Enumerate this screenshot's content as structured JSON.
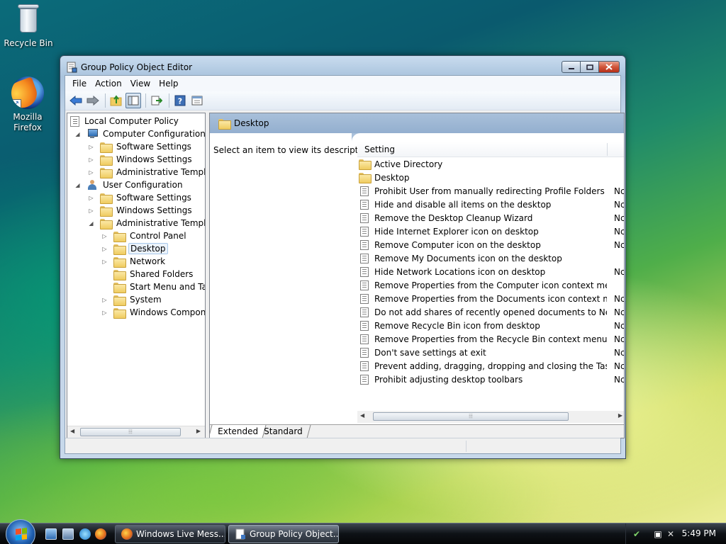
{
  "desktop": {
    "icons": [
      {
        "label": "Recycle Bin"
      },
      {
        "label": "Mozilla Firefox"
      }
    ]
  },
  "window": {
    "title": "Group Policy Object Editor",
    "menu": [
      "File",
      "Action",
      "View",
      "Help"
    ],
    "tree": [
      {
        "label": "Local Computer Policy",
        "icon": "policy-icon"
      },
      {
        "label": "Computer Configuration",
        "icon": "computer-icon"
      },
      {
        "label": "Software Settings",
        "icon": "folder-icon"
      },
      {
        "label": "Windows Settings",
        "icon": "folder-icon"
      },
      {
        "label": "Administrative Templates",
        "icon": "folder-icon"
      },
      {
        "label": "User Configuration",
        "icon": "user-icon"
      },
      {
        "label": "Software Settings",
        "icon": "folder-icon"
      },
      {
        "label": "Windows Settings",
        "icon": "folder-icon"
      },
      {
        "label": "Administrative Templates",
        "icon": "folder-icon"
      },
      {
        "label": "Control Panel",
        "icon": "folder-icon"
      },
      {
        "label": "Desktop",
        "icon": "folder-icon",
        "selected": true
      },
      {
        "label": "Network",
        "icon": "folder-icon"
      },
      {
        "label": "Shared Folders",
        "icon": "folder-icon"
      },
      {
        "label": "Start Menu and Taskbar",
        "icon": "folder-icon"
      },
      {
        "label": "System",
        "icon": "folder-icon"
      },
      {
        "label": "Windows Components",
        "icon": "folder-icon"
      }
    ],
    "right_pane": {
      "header_title": "Desktop",
      "description": "Select an item to view its description.",
      "column_setting": "Setting",
      "settings": [
        {
          "name": "Active Directory",
          "type": "folder",
          "state": ""
        },
        {
          "name": "Desktop",
          "type": "folder",
          "state": ""
        },
        {
          "name": "Prohibit User from manually redirecting Profile Folders",
          "type": "setting",
          "state": "Nc"
        },
        {
          "name": "Hide and disable all items on the desktop",
          "type": "setting",
          "state": "Nc"
        },
        {
          "name": "Remove the Desktop Cleanup Wizard",
          "type": "setting",
          "state": "Nc"
        },
        {
          "name": "Hide Internet Explorer icon on desktop",
          "type": "setting",
          "state": "Nc"
        },
        {
          "name": "Remove Computer icon on the desktop",
          "type": "setting",
          "state": "Nc"
        },
        {
          "name": "Remove My Documents icon on the desktop",
          "type": "setting",
          "state": ""
        },
        {
          "name": "Hide Network Locations icon on desktop",
          "type": "setting",
          "state": "Nc"
        },
        {
          "name": "Remove Properties from the Computer icon context menu",
          "type": "setting",
          "state": ""
        },
        {
          "name": "Remove Properties from the Documents icon context menu",
          "type": "setting",
          "state": "Nc"
        },
        {
          "name": "Do not add shares of recently opened documents to Networ...",
          "type": "setting",
          "state": "Nc"
        },
        {
          "name": "Remove Recycle Bin icon from desktop",
          "type": "setting",
          "state": "Nc"
        },
        {
          "name": "Remove Properties from the Recycle Bin context menu",
          "type": "setting",
          "state": "Nc"
        },
        {
          "name": "Don't save settings at exit",
          "type": "setting",
          "state": "Nc"
        },
        {
          "name": "Prevent adding, dragging, dropping and closing the Taskbar...",
          "type": "setting",
          "state": "Nc"
        },
        {
          "name": "Prohibit adjusting desktop toolbars",
          "type": "setting",
          "state": "Nc"
        }
      ],
      "tabs": [
        "Extended",
        "Standard"
      ]
    }
  },
  "taskbar": {
    "tasks": [
      {
        "label": "Windows Live Mess...",
        "active": false
      },
      {
        "label": "Group Policy Object...",
        "active": true
      }
    ],
    "clock": "5:49 PM"
  }
}
